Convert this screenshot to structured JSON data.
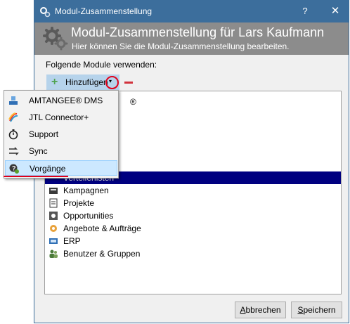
{
  "window": {
    "title": "Modul-Zusammenstellung",
    "help_label": "?",
    "close_label": "✕"
  },
  "header": {
    "title": "Modul-Zusammenstellung für Lars Kaufmann",
    "subtitle": "Hier können Sie die Modul-Zusammenstellung bearbeiten."
  },
  "modules_label": "Folgende Module verwenden:",
  "toolbar": {
    "add_label": "Hinzufügen",
    "add_caret": "▾"
  },
  "module_list": {
    "partial_top_text": "®",
    "selected_partial_text": "Verteilerlisten",
    "items": [
      {
        "label": "Kampagnen",
        "icon": "campaign-icon"
      },
      {
        "label": "Projekte",
        "icon": "project-icon"
      },
      {
        "label": "Opportunities",
        "icon": "opportunities-icon"
      },
      {
        "label": "Angebote & Aufträge",
        "icon": "offers-orders-icon"
      },
      {
        "label": "ERP",
        "icon": "erp-icon"
      },
      {
        "label": "Benutzer & Gruppen",
        "icon": "users-groups-icon"
      }
    ]
  },
  "dropdown": {
    "items": [
      {
        "label": "AMTANGEE® DMS",
        "icon": "dms-icon"
      },
      {
        "label": "JTL Connector+",
        "icon": "jtl-connector-icon"
      },
      {
        "label": "Support",
        "icon": "stopwatch-icon"
      },
      {
        "label": "Sync",
        "icon": "sync-arrows-icon"
      },
      {
        "label": "Vorgänge",
        "icon": "processes-icon"
      }
    ],
    "highlighted": "Vorgänge"
  },
  "buttons": {
    "cancel_prefix": "A",
    "cancel_rest": "bbrechen",
    "save_prefix": "S",
    "save_rest": "peichern"
  },
  "colors": {
    "titlebar": "#3c6e9c",
    "header": "#8c8c8c",
    "selection": "#000080",
    "add_button": "#b6d3eb",
    "annotation_red": "#e0001a",
    "menu_hover": "#cce8ff"
  }
}
